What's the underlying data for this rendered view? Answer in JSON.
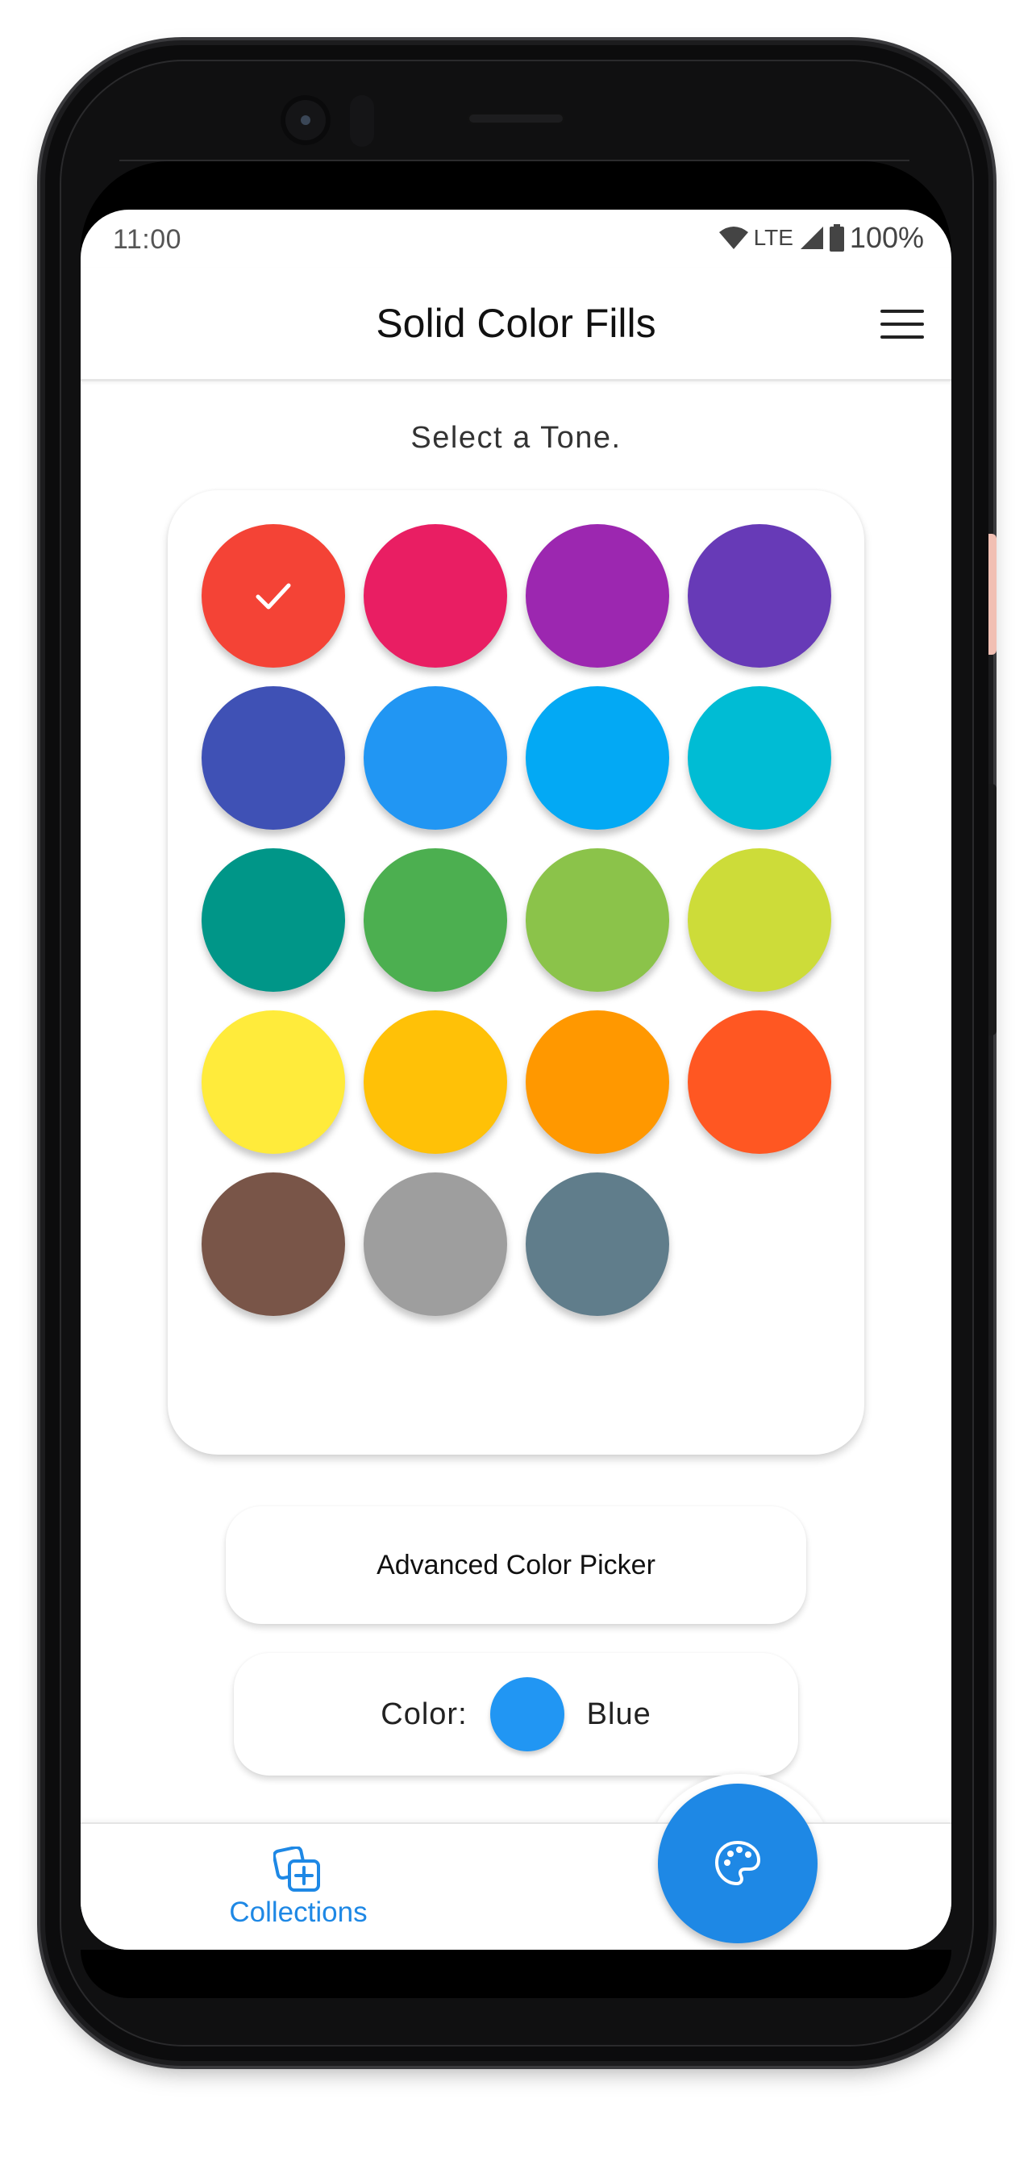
{
  "status_bar": {
    "time": "11:00",
    "network": "LTE",
    "battery": "100%"
  },
  "app_bar": {
    "title": "Solid Color Fills",
    "menu_icon": "hamburger-menu-icon"
  },
  "main": {
    "prompt": "Select a Tone.",
    "swatches": [
      {
        "color": "#F44336",
        "selected": true
      },
      {
        "color": "#E91E63",
        "selected": false
      },
      {
        "color": "#9C27B0",
        "selected": false
      },
      {
        "color": "#673AB7",
        "selected": false
      },
      {
        "color": "#3F51B5",
        "selected": false
      },
      {
        "color": "#2196F3",
        "selected": false
      },
      {
        "color": "#03A9F4",
        "selected": false
      },
      {
        "color": "#00BCD4",
        "selected": false
      },
      {
        "color": "#009688",
        "selected": false
      },
      {
        "color": "#4CAF50",
        "selected": false
      },
      {
        "color": "#8BC34A",
        "selected": false
      },
      {
        "color": "#CDDC39",
        "selected": false
      },
      {
        "color": "#FFEB3B",
        "selected": false
      },
      {
        "color": "#FFC107",
        "selected": false
      },
      {
        "color": "#FF9800",
        "selected": false
      },
      {
        "color": "#FF5722",
        "selected": false
      },
      {
        "color": "#795548",
        "selected": false
      },
      {
        "color": "#9E9E9E",
        "selected": false
      },
      {
        "color": "#607D8B",
        "selected": false
      }
    ],
    "advanced_button_label": "Advanced Color Picker",
    "current_color": {
      "label": "Color:",
      "value": "Blue",
      "swatch": "#2196F3"
    }
  },
  "bottom_nav": {
    "collections_label": "Collections",
    "collections_icon": "add-to-collection-icon",
    "fab_icon": "palette-icon",
    "accent": "#1E88E5"
  }
}
